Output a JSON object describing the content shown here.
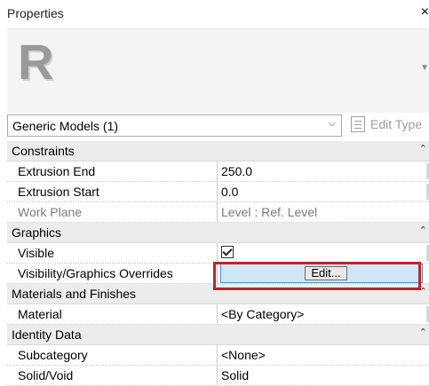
{
  "panel": {
    "title": "Properties",
    "close_glyph": "×"
  },
  "logo": {
    "letter": "R",
    "icon": "revit-logo-icon"
  },
  "type_selector": {
    "value": "Generic Models (1)",
    "edit_type_label": "Edit Type"
  },
  "groups": [
    {
      "label": "Constraints",
      "rows": [
        {
          "name": "Extrusion End",
          "value": "250.0"
        },
        {
          "name": "Extrusion Start",
          "value": "0.0"
        },
        {
          "name": "Work Plane",
          "value": "Level : Ref. Level",
          "disabled": true
        }
      ]
    },
    {
      "label": "Graphics",
      "rows": [
        {
          "name": "Visible",
          "value": "checked"
        },
        {
          "name": "Visibility/Graphics Overrides",
          "button": "Edit..."
        }
      ]
    },
    {
      "label": "Materials and Finishes",
      "rows": [
        {
          "name": "Material",
          "value": "<By Category>"
        }
      ]
    },
    {
      "label": "Identity Data",
      "rows": [
        {
          "name": "Subcategory",
          "value": "<None>"
        },
        {
          "name": "Solid/Void",
          "value": "Solid"
        }
      ]
    }
  ],
  "colors": {
    "highlight_border": "#c0232b",
    "selected_field": "#cfe6f7"
  }
}
